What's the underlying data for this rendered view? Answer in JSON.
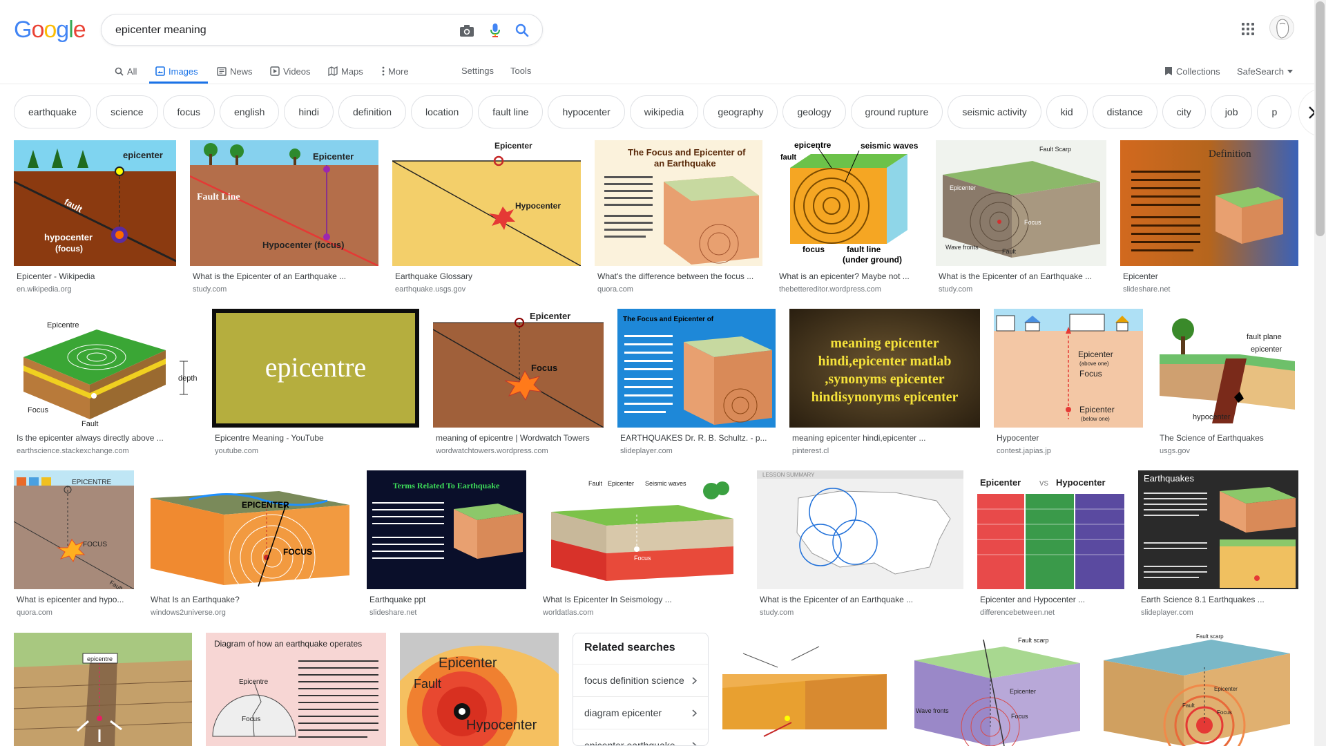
{
  "search": {
    "query": "epicenter meaning"
  },
  "tabs": [
    {
      "label": "All",
      "icon": "search-icon"
    },
    {
      "label": "Images",
      "icon": "image-icon",
      "active": true
    },
    {
      "label": "News",
      "icon": "news-icon"
    },
    {
      "label": "Videos",
      "icon": "video-icon"
    },
    {
      "label": "Maps",
      "icon": "map-icon"
    },
    {
      "label": "More",
      "icon": "more-vertical-icon"
    }
  ],
  "tools": {
    "settings": "Settings",
    "tools": "Tools",
    "collections": "Collections",
    "safesearch": "SafeSearch"
  },
  "chips": [
    "earthquake",
    "science",
    "focus",
    "english",
    "hindi",
    "definition",
    "location",
    "fault line",
    "hypocenter",
    "wikipedia",
    "geography",
    "geology",
    "ground rupture",
    "seismic activity",
    "kid",
    "distance",
    "city",
    "job",
    "p"
  ],
  "row1": [
    {
      "title": "Epicenter - Wikipedia",
      "source": "en.wikipedia.org"
    },
    {
      "title": "What is the Epicenter of an Earthquake ...",
      "source": "study.com"
    },
    {
      "title": "Earthquake Glossary",
      "source": "earthquake.usgs.gov"
    },
    {
      "title": "What's the difference between the focus ...",
      "source": "quora.com"
    },
    {
      "title": "What is an epicenter? Maybe not ...",
      "source": "thebettereditor.wordpress.com"
    },
    {
      "title": "What is the Epicenter of an Earthquake ...",
      "source": "study.com"
    },
    {
      "title": "Epicenter",
      "source": "slideshare.net"
    }
  ],
  "row2": [
    {
      "title": "Is the epicenter always directly above ...",
      "source": "earthscience.stackexchange.com"
    },
    {
      "title": "Epicentre Meaning - YouTube",
      "source": "youtube.com"
    },
    {
      "title": "meaning of epicentre | Wordwatch Towers",
      "source": "wordwatchtowers.wordpress.com"
    },
    {
      "title": "EARTHQUAKES Dr. R. B. Schultz. - p...",
      "source": "slideplayer.com"
    },
    {
      "title": "meaning epicenter hindi,epicenter ...",
      "source": "pinterest.cl"
    },
    {
      "title": "Hypocenter",
      "source": "contest.japias.jp"
    },
    {
      "title": "The Science of Earthquakes",
      "source": "usgs.gov"
    }
  ],
  "row3": [
    {
      "title": "What is epicenter and hypo...",
      "source": "quora.com"
    },
    {
      "title": "What Is an Earthquake?",
      "source": "windows2universe.org"
    },
    {
      "title": "Earthquake ppt",
      "source": "slideshare.net"
    },
    {
      "title": "What Is Epicenter In Seismology ...",
      "source": "worldatlas.com"
    },
    {
      "title": "What is the Epicenter of an Earthquake ...",
      "source": "study.com"
    },
    {
      "title": "Epicenter and Hypocenter ...",
      "source": "differencebetween.net"
    },
    {
      "title": "Earth Science 8.1 Earthquakes ...",
      "source": "slideplayer.com"
    }
  ],
  "imgtext": {
    "epicenter": "epicenter",
    "Epicenter": "Epicenter",
    "epicentre": "epicentre",
    "Epicentre": "Epicentre",
    "EPICENTRE": "EPICENTRE",
    "EPICENTER": "EPICENTER",
    "fault": "fault",
    "Fault": "Fault",
    "Fault_Line": "Fault Line",
    "hypocenter_focus": "hypocenter",
    "paren_focus": "(focus)",
    "Hypocenter_focus": "Hypocenter (focus)",
    "Hypocenter": "Hypocenter",
    "hypocenter": "hypocenter",
    "Focus": "Focus",
    "focus": "focus",
    "FOCUS": "FOCUS",
    "seismic_waves": "seismic waves",
    "fault_line": "fault line",
    "fault_line_under": "fault line",
    "under_ground": "(under ground)",
    "Fault_Scarp": "Fault Scarp",
    "Wave_fronts": "Wave fronts",
    "Definition": "Definition",
    "depth": "depth",
    "fault_plane": "fault plane",
    "q3_title_a": "The Focus and Epicenter of",
    "q3_title_b": "an Earthquake",
    "eq_title": "EARTHQUAKES",
    "terms_title": "Terms Related To Earthquake",
    "seismic_waves_cap": "Seismic waves",
    "epi_vs_hypo_a": "Epicenter",
    "epi_vs_hypo_vs": "vs",
    "epi_vs_hypo_b": "Hypocenter",
    "earthquakes_cap": "Earthquakes",
    "diagram_title": "Diagram of how an earthquake operates",
    "hindi_1": "meaning epicenter",
    "hindi_2": "hindi,epicenter matlab",
    "hindi_3": ",synonyms epicenter",
    "hindi_4": "hindisynonyms epicenter",
    "above_one": "(above one)",
    "below_one": "(below one)",
    "lesson_summary": "LESSON SUMMARY",
    "fault_scarp": "Fault scarp"
  },
  "related": {
    "title": "Related searches",
    "items": [
      "focus definition science",
      "diagram epicenter",
      "epicenter earthquake"
    ]
  }
}
